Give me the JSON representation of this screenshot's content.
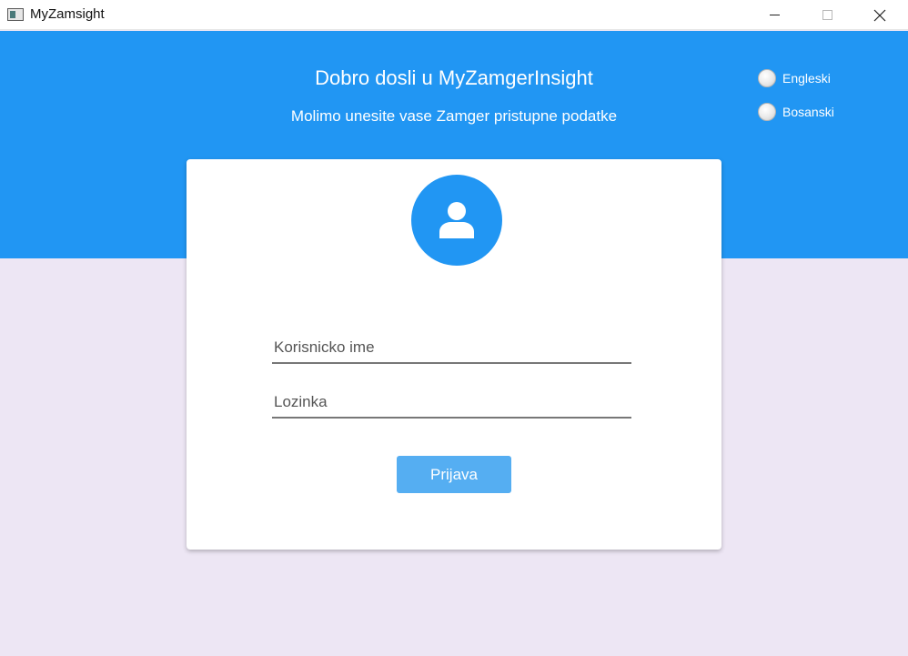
{
  "window": {
    "title": "MyZamsight"
  },
  "header": {
    "welcome": "Dobro dosli u MyZamgerInsight",
    "subtitle": "Molimo unesite vase Zamger pristupne podatke",
    "background_color": "#2196f3"
  },
  "language": {
    "options": [
      {
        "label": "Engleski",
        "selected": false
      },
      {
        "label": "Bosanski",
        "selected": false
      }
    ]
  },
  "login": {
    "username_placeholder": "Korisnicko ime",
    "password_placeholder": "Lozinka",
    "submit_label": "Prijava",
    "button_color": "#55aef2"
  },
  "icons": {
    "avatar": "user-icon"
  }
}
